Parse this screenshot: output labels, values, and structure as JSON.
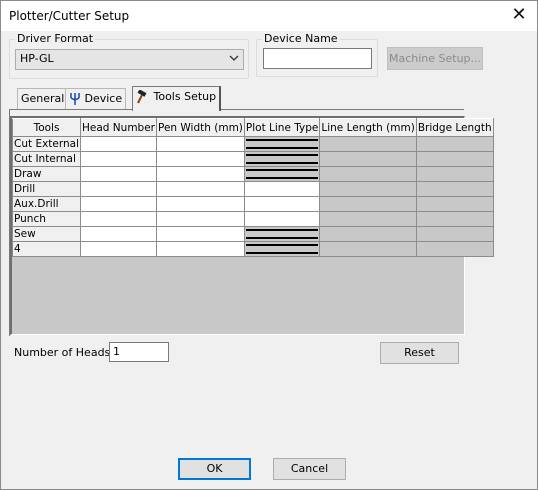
{
  "window": {
    "title": "Plotter/Cutter Setup"
  },
  "driver_format": {
    "label": "Driver Format",
    "value": "HP-GL"
  },
  "device_name": {
    "label": "Device Name",
    "value": ""
  },
  "machine_setup_label": "Machine Setup...",
  "tabs": [
    {
      "label": "General",
      "icon": ""
    },
    {
      "label": "Device",
      "icon": "trident-icon"
    },
    {
      "label": "Tools Setup",
      "icon": "hammer-icon"
    }
  ],
  "grid": {
    "columns": [
      "Tools",
      "Head Number",
      "Pen Width (mm)",
      "Plot Line Type",
      "Line Length (mm)",
      "Bridge Length"
    ],
    "rows": [
      {
        "tool": "Cut External",
        "head": "",
        "pen": "",
        "line_type": "solid-double",
        "line_len": "",
        "bridge": ""
      },
      {
        "tool": "Cut Internal",
        "head": "",
        "pen": "",
        "line_type": "solid-double",
        "line_len": "",
        "bridge": ""
      },
      {
        "tool": "Draw",
        "head": "",
        "pen": "",
        "line_type": "solid-double",
        "line_len": "",
        "bridge": ""
      },
      {
        "tool": "Drill",
        "head": "",
        "pen": "",
        "line_type": "none",
        "line_len": "",
        "bridge": ""
      },
      {
        "tool": "Aux.Drill",
        "head": "",
        "pen": "",
        "line_type": "none",
        "line_len": "",
        "bridge": ""
      },
      {
        "tool": "Punch",
        "head": "",
        "pen": "",
        "line_type": "none",
        "line_len": "",
        "bridge": ""
      },
      {
        "tool": "Sew",
        "head": "",
        "pen": "",
        "line_type": "solid-double",
        "line_len": "",
        "bridge": ""
      },
      {
        "tool": "4",
        "head": "",
        "pen": "",
        "line_type": "solid-double",
        "line_len": "",
        "bridge": ""
      }
    ]
  },
  "number_of_heads": {
    "label": "Number of Heads",
    "value": "1"
  },
  "reset_label": "Reset",
  "ok_label": "OK",
  "cancel_label": "Cancel"
}
